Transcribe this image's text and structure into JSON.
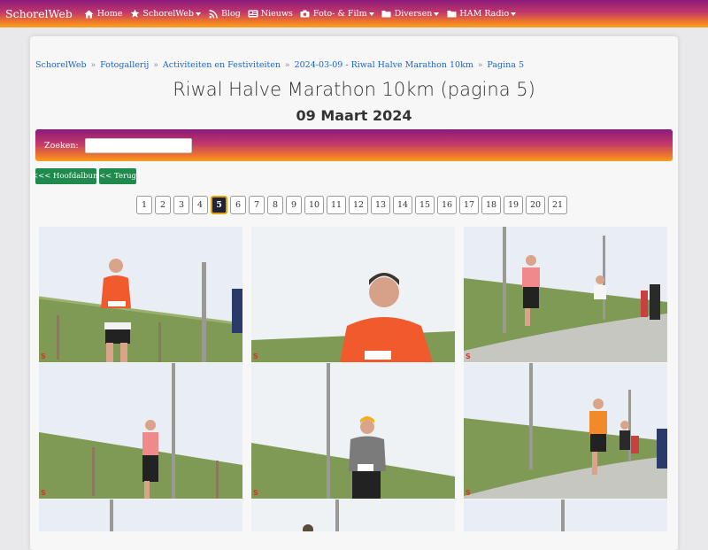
{
  "nav": {
    "brand": "SchorelWeb",
    "items": [
      {
        "label": "Home",
        "icon": "home-icon",
        "dropdown": false
      },
      {
        "label": "SchorelWeb",
        "icon": "star-icon",
        "dropdown": true
      },
      {
        "label": "Blog",
        "icon": "rss-icon",
        "dropdown": false
      },
      {
        "label": "Nieuws",
        "icon": "newspaper-icon",
        "dropdown": false
      },
      {
        "label": "Foto- & Film",
        "icon": "camera-icon",
        "dropdown": true
      },
      {
        "label": "Diversen",
        "icon": "folder-icon",
        "dropdown": true
      },
      {
        "label": "HAM Radio",
        "icon": "folder-icon",
        "dropdown": true
      }
    ]
  },
  "breadcrumb": [
    "SchorelWeb",
    "Fotogallerij",
    "Activiteiten en Festiviteiten",
    "2024-03-09 - Riwal Halve Marathon 10km",
    "Pagina 5"
  ],
  "page": {
    "title": "Riwal Halve Marathon 10km (pagina 5)",
    "date": "09 Maart 2024"
  },
  "search": {
    "label": "Zoeken:",
    "value": ""
  },
  "buttons": {
    "main_album": "<<< Hoofdalbum",
    "back": "<< Terug"
  },
  "pagination": {
    "pages": [
      "1",
      "2",
      "3",
      "4",
      "5",
      "6",
      "7",
      "8",
      "9",
      "10",
      "11",
      "12",
      "13",
      "14",
      "15",
      "16",
      "17",
      "18",
      "19",
      "20",
      "21"
    ],
    "active": "5"
  },
  "photo_watermark": "S",
  "colors": {
    "nav_gradient_top": "#8a1a7a",
    "nav_gradient_bottom": "#f7a11c",
    "button_green": "#1f8a4c",
    "link_blue": "#1a66c9",
    "page_active_bg": "#1f2333",
    "page_active_border": "#e3a20b"
  }
}
